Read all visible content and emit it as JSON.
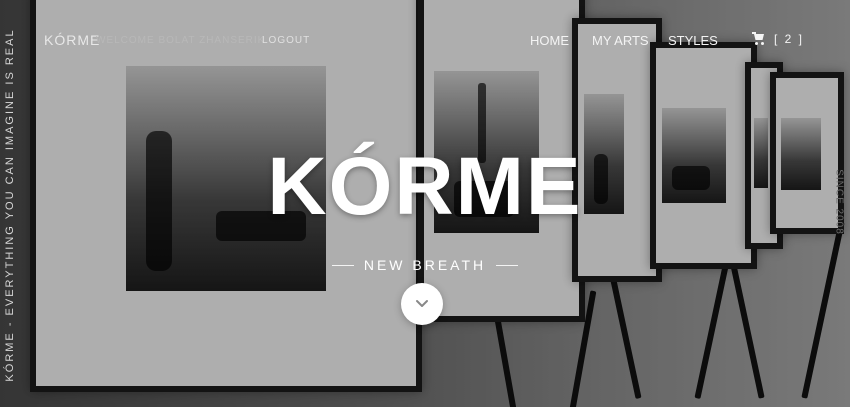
{
  "header": {
    "logo_text": "KÓRME",
    "welcome_text": "WELCOME BOLAT ZHANSERIK",
    "logout_label": "LOGOUT",
    "menu": [
      {
        "label": "HOME"
      },
      {
        "label": "MY ARTS"
      },
      {
        "label": "STYLES"
      }
    ],
    "cart": {
      "icon": "cart-icon",
      "count_label": "[ 2 ]"
    }
  },
  "hero": {
    "title": "KÓRME",
    "subtitle": "NEW BREATH",
    "scroll_button_icon": "chevron-down-icon"
  },
  "side_texts": {
    "left": "KÓRME - EVERYTHING YOU CAN IMAGINE IS REAL",
    "right": "SINCE 2008"
  },
  "colors": {
    "text_primary": "#ffffff",
    "text_muted": "#b8b8b8",
    "button_bg": "#ffffff",
    "icon_color": "#888888"
  }
}
